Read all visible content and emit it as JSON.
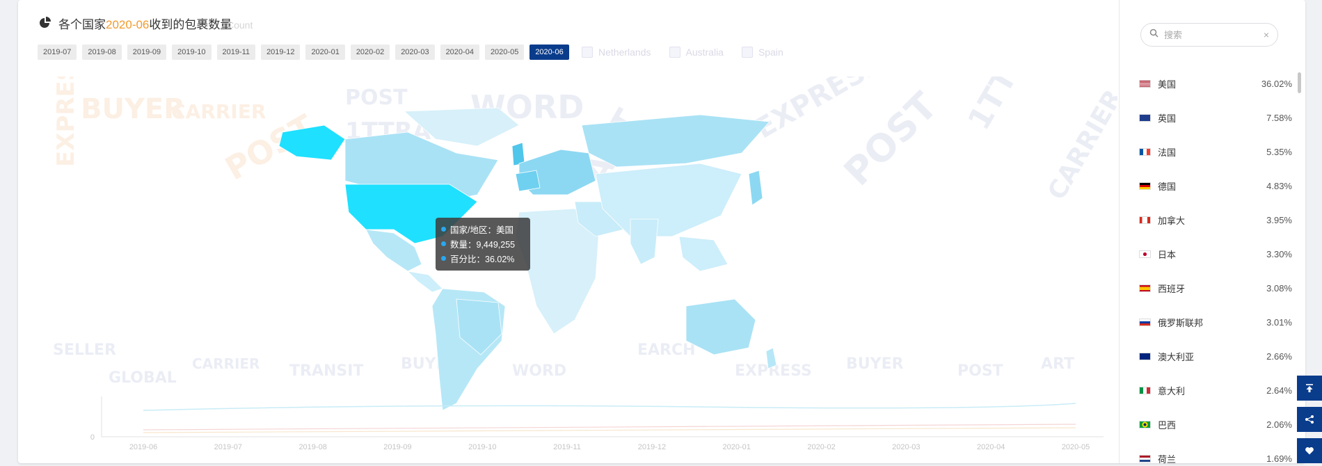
{
  "header": {
    "title_prefix": "各个国家",
    "title_month": "2020-06",
    "title_suffix": "收到的包裹数量",
    "ghost_legend": "Count"
  },
  "months": [
    {
      "label": "2019-07",
      "active": false
    },
    {
      "label": "2019-08",
      "active": false
    },
    {
      "label": "2019-09",
      "active": false
    },
    {
      "label": "2019-10",
      "active": false
    },
    {
      "label": "2019-11",
      "active": false
    },
    {
      "label": "2019-12",
      "active": false
    },
    {
      "label": "2020-01",
      "active": false
    },
    {
      "label": "2020-02",
      "active": false
    },
    {
      "label": "2020-03",
      "active": false
    },
    {
      "label": "2020-04",
      "active": false
    },
    {
      "label": "2020-05",
      "active": false
    },
    {
      "label": "2020-06",
      "active": true
    }
  ],
  "country_legend": [
    "Netherlands",
    "Australia",
    "Spain"
  ],
  "tooltip": {
    "country": "国家/地区：美国",
    "count": "数量：9,449,255",
    "percent": "百分比：36.02%"
  },
  "timeline": {
    "zero": "0",
    "ticks": [
      "2019-06",
      "2019-07",
      "2019-08",
      "2019-09",
      "2019-10",
      "2019-11",
      "2019-12",
      "2020-01",
      "2020-02",
      "2020-03",
      "2020-04",
      "2020-05"
    ]
  },
  "search": {
    "placeholder": "搜索",
    "clear": "×"
  },
  "ranking": [
    {
      "name": "美国",
      "pct": "36.02%",
      "flag": "us"
    },
    {
      "name": "英国",
      "pct": "7.58%",
      "flag": "gb"
    },
    {
      "name": "法国",
      "pct": "5.35%",
      "flag": "fr"
    },
    {
      "name": "德国",
      "pct": "4.83%",
      "flag": "de"
    },
    {
      "name": "加拿大",
      "pct": "3.95%",
      "flag": "ca"
    },
    {
      "name": "日本",
      "pct": "3.30%",
      "flag": "jp"
    },
    {
      "name": "西班牙",
      "pct": "3.08%",
      "flag": "es"
    },
    {
      "name": "俄罗斯联邦",
      "pct": "3.01%",
      "flag": "ru"
    },
    {
      "name": "澳大利亚",
      "pct": "2.66%",
      "flag": "au"
    },
    {
      "name": "意大利",
      "pct": "2.64%",
      "flag": "it"
    },
    {
      "name": "巴西",
      "pct": "2.06%",
      "flag": "br"
    },
    {
      "name": "荷兰",
      "pct": "1.69%",
      "flag": "nl"
    }
  ],
  "colors": {
    "accent": "#0a3c8c",
    "highlight": "#f39b2d",
    "map_light": "#d7f0fa",
    "map_mid": "#a9e2f5",
    "map_top": "#1fe0ff"
  }
}
